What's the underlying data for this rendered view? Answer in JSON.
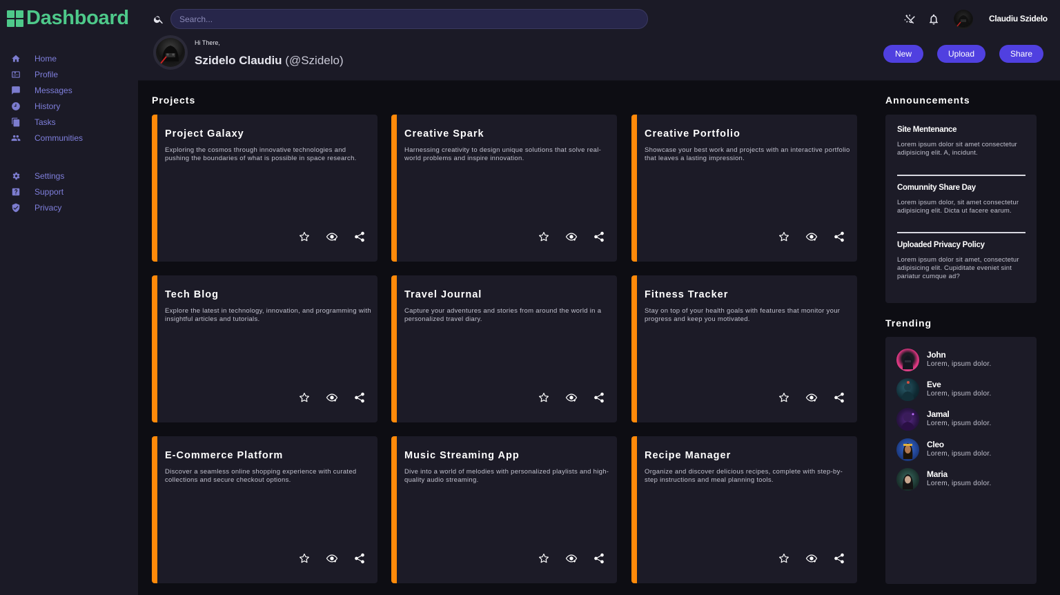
{
  "app": {
    "logo_text": "Dashboard",
    "brand_color": "#4ec98a",
    "accent_color": "#5040e0",
    "card_accent_color": "#ff8a0a"
  },
  "sidebar": {
    "main_items": [
      {
        "label": "Home",
        "icon": "home-icon"
      },
      {
        "label": "Profile",
        "icon": "profile-card-icon"
      },
      {
        "label": "Messages",
        "icon": "message-icon"
      },
      {
        "label": "History",
        "icon": "clock-icon"
      },
      {
        "label": "Tasks",
        "icon": "document-icon"
      },
      {
        "label": "Communities",
        "icon": "people-icon"
      }
    ],
    "secondary_items": [
      {
        "label": "Settings",
        "icon": "gear-icon"
      },
      {
        "label": "Support",
        "icon": "help-icon"
      },
      {
        "label": "Privacy",
        "icon": "shield-icon"
      }
    ]
  },
  "header": {
    "search_placeholder": "Search...",
    "user_name": "Claudiu Szidelo",
    "greeting": "Hi There,",
    "full_name": "Szidelo Claudiu",
    "handle": "(@Szidelo)",
    "buttons": {
      "new": "New",
      "upload": "Upload",
      "share": "Share"
    }
  },
  "projects": {
    "title": "Projects",
    "items": [
      {
        "title": "Project Galaxy",
        "description": "Exploring the cosmos through innovative technologies and pushing the boundaries of what is possible in space research."
      },
      {
        "title": "Creative Spark",
        "description": "Harnessing creativity to design unique solutions that solve real-world problems and inspire innovation."
      },
      {
        "title": "Creative Portfolio",
        "description": "Showcase your best work and projects with an interactive portfolio that leaves a lasting impression."
      },
      {
        "title": "Tech Blog",
        "description": "Explore the latest in technology, innovation, and programming with insightful articles and tutorials."
      },
      {
        "title": "Travel Journal",
        "description": "Capture your adventures and stories from around the world in a personalized travel diary."
      },
      {
        "title": "Fitness Tracker",
        "description": "Stay on top of your health goals with features that monitor your progress and keep you motivated."
      },
      {
        "title": "E-Commerce Platform",
        "description": "Discover a seamless online shopping experience with curated collections and secure checkout options."
      },
      {
        "title": "Music Streaming App",
        "description": "Dive into a world of melodies with personalized playlists and high-quality audio streaming."
      },
      {
        "title": "Recipe Manager",
        "description": "Organize and discover delicious recipes, complete with step-by-step instructions and meal planning tools."
      }
    ]
  },
  "announcements": {
    "title": "Announcements",
    "items": [
      {
        "title": "Site Mentenance",
        "body": "Lorem ipsum dolor sit amet consectetur adipisicing elit. A, incidunt."
      },
      {
        "title": "Comunnity Share Day",
        "body": "Lorem ipsum dolor, sit amet consectetur adipisicing elit. Dicta ut facere earum."
      },
      {
        "title": "Uploaded Privacy Policy",
        "body": "Lorem ipsum dolor sit amet, consectetur adipisicing elit. Cupiditate eveniet sint pariatur cumque ad?"
      }
    ]
  },
  "trending": {
    "title": "Trending",
    "items": [
      {
        "name": "John",
        "subtitle": "Lorem, ipsum dolor."
      },
      {
        "name": "Eve",
        "subtitle": "Lorem, ipsum dolor."
      },
      {
        "name": "Jamal",
        "subtitle": "Lorem, ipsum dolor."
      },
      {
        "name": "Cleo",
        "subtitle": "Lorem, ipsum dolor."
      },
      {
        "name": "Maria",
        "subtitle": "Lorem, ipsum dolor."
      }
    ]
  }
}
